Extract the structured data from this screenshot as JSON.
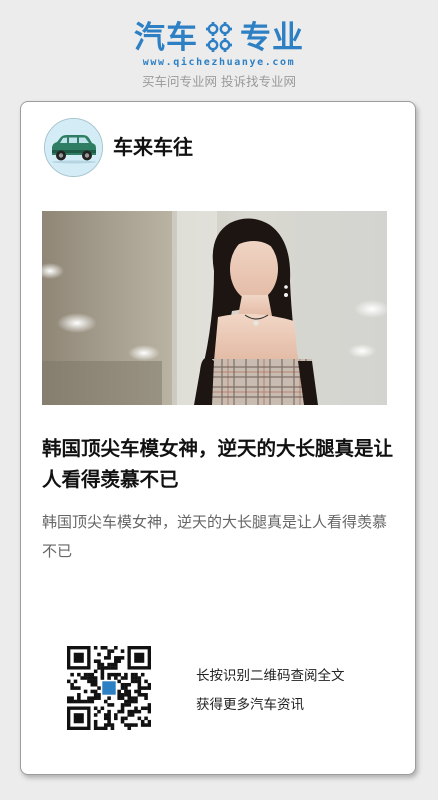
{
  "header": {
    "logo_left": "汽车",
    "logo_right": "专业",
    "logo_icon": "gears-icon",
    "domain": "www.qichezhuanye.com",
    "tagline": "买车问专业网 投诉找专业网"
  },
  "article": {
    "author": "车来车往",
    "author_avatar_icon": "car-icon",
    "title": "韩国顶尖车模女神，逆天的大长腿真是让人看得羡慕不已",
    "summary": "韩国顶尖车模女神，逆天的大长腿真是让人看得羡慕不已"
  },
  "share": {
    "qr_icon": "qr-code-icon",
    "line1": "长按识别二维码查阅全文",
    "line2": "获得更多汽车资讯"
  },
  "colors": {
    "brand": "#2e80c4",
    "background": "#ececec",
    "card": "#ffffff"
  }
}
